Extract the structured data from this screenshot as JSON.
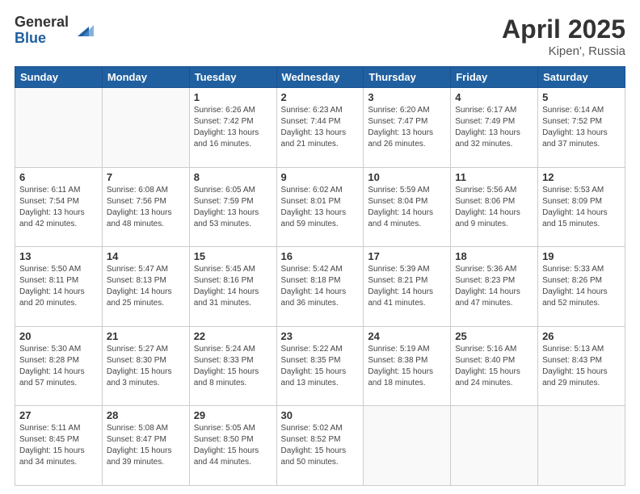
{
  "header": {
    "logo_general": "General",
    "logo_blue": "Blue",
    "month": "April 2025",
    "location": "Kipen', Russia"
  },
  "weekdays": [
    "Sunday",
    "Monday",
    "Tuesday",
    "Wednesday",
    "Thursday",
    "Friday",
    "Saturday"
  ],
  "weeks": [
    [
      {
        "date": "",
        "info": ""
      },
      {
        "date": "",
        "info": ""
      },
      {
        "date": "1",
        "info": "Sunrise: 6:26 AM\nSunset: 7:42 PM\nDaylight: 13 hours and 16 minutes."
      },
      {
        "date": "2",
        "info": "Sunrise: 6:23 AM\nSunset: 7:44 PM\nDaylight: 13 hours and 21 minutes."
      },
      {
        "date": "3",
        "info": "Sunrise: 6:20 AM\nSunset: 7:47 PM\nDaylight: 13 hours and 26 minutes."
      },
      {
        "date": "4",
        "info": "Sunrise: 6:17 AM\nSunset: 7:49 PM\nDaylight: 13 hours and 32 minutes."
      },
      {
        "date": "5",
        "info": "Sunrise: 6:14 AM\nSunset: 7:52 PM\nDaylight: 13 hours and 37 minutes."
      }
    ],
    [
      {
        "date": "6",
        "info": "Sunrise: 6:11 AM\nSunset: 7:54 PM\nDaylight: 13 hours and 42 minutes."
      },
      {
        "date": "7",
        "info": "Sunrise: 6:08 AM\nSunset: 7:56 PM\nDaylight: 13 hours and 48 minutes."
      },
      {
        "date": "8",
        "info": "Sunrise: 6:05 AM\nSunset: 7:59 PM\nDaylight: 13 hours and 53 minutes."
      },
      {
        "date": "9",
        "info": "Sunrise: 6:02 AM\nSunset: 8:01 PM\nDaylight: 13 hours and 59 minutes."
      },
      {
        "date": "10",
        "info": "Sunrise: 5:59 AM\nSunset: 8:04 PM\nDaylight: 14 hours and 4 minutes."
      },
      {
        "date": "11",
        "info": "Sunrise: 5:56 AM\nSunset: 8:06 PM\nDaylight: 14 hours and 9 minutes."
      },
      {
        "date": "12",
        "info": "Sunrise: 5:53 AM\nSunset: 8:09 PM\nDaylight: 14 hours and 15 minutes."
      }
    ],
    [
      {
        "date": "13",
        "info": "Sunrise: 5:50 AM\nSunset: 8:11 PM\nDaylight: 14 hours and 20 minutes."
      },
      {
        "date": "14",
        "info": "Sunrise: 5:47 AM\nSunset: 8:13 PM\nDaylight: 14 hours and 25 minutes."
      },
      {
        "date": "15",
        "info": "Sunrise: 5:45 AM\nSunset: 8:16 PM\nDaylight: 14 hours and 31 minutes."
      },
      {
        "date": "16",
        "info": "Sunrise: 5:42 AM\nSunset: 8:18 PM\nDaylight: 14 hours and 36 minutes."
      },
      {
        "date": "17",
        "info": "Sunrise: 5:39 AM\nSunset: 8:21 PM\nDaylight: 14 hours and 41 minutes."
      },
      {
        "date": "18",
        "info": "Sunrise: 5:36 AM\nSunset: 8:23 PM\nDaylight: 14 hours and 47 minutes."
      },
      {
        "date": "19",
        "info": "Sunrise: 5:33 AM\nSunset: 8:26 PM\nDaylight: 14 hours and 52 minutes."
      }
    ],
    [
      {
        "date": "20",
        "info": "Sunrise: 5:30 AM\nSunset: 8:28 PM\nDaylight: 14 hours and 57 minutes."
      },
      {
        "date": "21",
        "info": "Sunrise: 5:27 AM\nSunset: 8:30 PM\nDaylight: 15 hours and 3 minutes."
      },
      {
        "date": "22",
        "info": "Sunrise: 5:24 AM\nSunset: 8:33 PM\nDaylight: 15 hours and 8 minutes."
      },
      {
        "date": "23",
        "info": "Sunrise: 5:22 AM\nSunset: 8:35 PM\nDaylight: 15 hours and 13 minutes."
      },
      {
        "date": "24",
        "info": "Sunrise: 5:19 AM\nSunset: 8:38 PM\nDaylight: 15 hours and 18 minutes."
      },
      {
        "date": "25",
        "info": "Sunrise: 5:16 AM\nSunset: 8:40 PM\nDaylight: 15 hours and 24 minutes."
      },
      {
        "date": "26",
        "info": "Sunrise: 5:13 AM\nSunset: 8:43 PM\nDaylight: 15 hours and 29 minutes."
      }
    ],
    [
      {
        "date": "27",
        "info": "Sunrise: 5:11 AM\nSunset: 8:45 PM\nDaylight: 15 hours and 34 minutes."
      },
      {
        "date": "28",
        "info": "Sunrise: 5:08 AM\nSunset: 8:47 PM\nDaylight: 15 hours and 39 minutes."
      },
      {
        "date": "29",
        "info": "Sunrise: 5:05 AM\nSunset: 8:50 PM\nDaylight: 15 hours and 44 minutes."
      },
      {
        "date": "30",
        "info": "Sunrise: 5:02 AM\nSunset: 8:52 PM\nDaylight: 15 hours and 50 minutes."
      },
      {
        "date": "",
        "info": ""
      },
      {
        "date": "",
        "info": ""
      },
      {
        "date": "",
        "info": ""
      }
    ]
  ]
}
